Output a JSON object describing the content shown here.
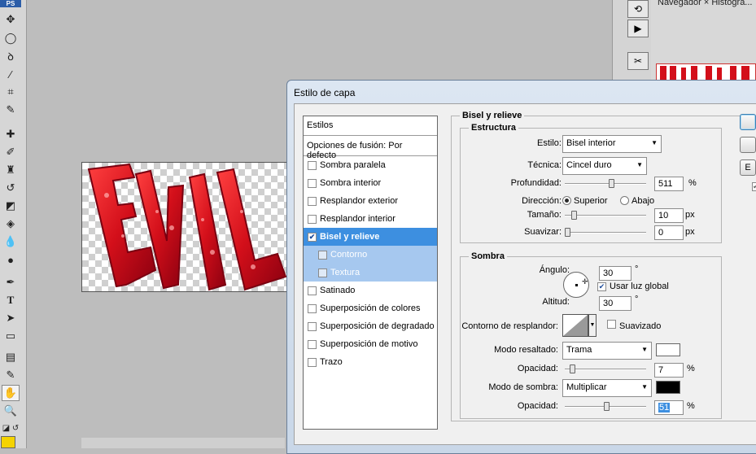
{
  "toolbox": {
    "logo": "PS",
    "tools": [
      "move",
      "marquee",
      "lasso",
      "magic-wand",
      "crop",
      "eyedropper",
      "healing",
      "brush",
      "stamp",
      "history-brush",
      "eraser",
      "paint-bucket",
      "blur",
      "dodge",
      "pen",
      "type",
      "path-select",
      "shape",
      "notes",
      "eyedropper2",
      "hand",
      "zoom"
    ],
    "foreground_color": "#f5d300"
  },
  "panel": {
    "navigator_tab": "Navegador ×   Histogra..."
  },
  "canvas": {
    "text": "EVIL"
  },
  "dialog": {
    "title": "Estilo de capa",
    "styles_header": "Estilos",
    "blend_options": "Opciones de fusión: Por defecto",
    "styles": [
      {
        "label": "Sombra paralela",
        "checked": false
      },
      {
        "label": "Sombra interior",
        "checked": false
      },
      {
        "label": "Resplandor exterior",
        "checked": false
      },
      {
        "label": "Resplandor interior",
        "checked": false
      },
      {
        "label": "Bisel y relieve",
        "checked": true
      },
      {
        "label": "Contorno",
        "checked": false
      },
      {
        "label": "Textura",
        "checked": false
      },
      {
        "label": "Satinado",
        "checked": false
      },
      {
        "label": "Superposición de colores",
        "checked": false
      },
      {
        "label": "Superposición de degradado",
        "checked": false
      },
      {
        "label": "Superposición de motivo",
        "checked": false
      },
      {
        "label": "Trazo",
        "checked": false
      }
    ],
    "section_title": "Bisel y relieve",
    "structure": {
      "title": "Estructura",
      "style_label": "Estilo:",
      "style_value": "Bisel interior",
      "technique_label": "Técnica:",
      "technique_value": "Cincel duro",
      "depth_label": "Profundidad:",
      "depth_value": "511",
      "depth_unit": "%",
      "direction_label": "Dirección:",
      "direction_up": "Superior",
      "direction_down": "Abajo",
      "size_label": "Tamaño:",
      "size_value": "10",
      "size_unit": "px",
      "soften_label": "Suavizar:",
      "soften_value": "0",
      "soften_unit": "px"
    },
    "shading": {
      "title": "Sombra",
      "angle_label": "Ángulo:",
      "angle_value": "30",
      "angle_unit": "°",
      "global_light": "Usar luz global",
      "altitude_label": "Altitud:",
      "altitude_value": "30",
      "altitude_unit": "°",
      "gloss_label": "Contorno de resplandor:",
      "antialias": "Suavizado",
      "highlight_mode_label": "Modo resaltado:",
      "highlight_mode_value": "Trama",
      "highlight_color": "#ffffff",
      "highlight_opacity_label": "Opacidad:",
      "highlight_opacity_value": "7",
      "opacity_unit": "%",
      "shadow_mode_label": "Modo de sombra:",
      "shadow_mode_value": "Multiplicar",
      "shadow_color": "#000000",
      "shadow_opacity_label": "Opacidad:",
      "shadow_opacity_value": "51"
    },
    "side_button_label": "E"
  }
}
